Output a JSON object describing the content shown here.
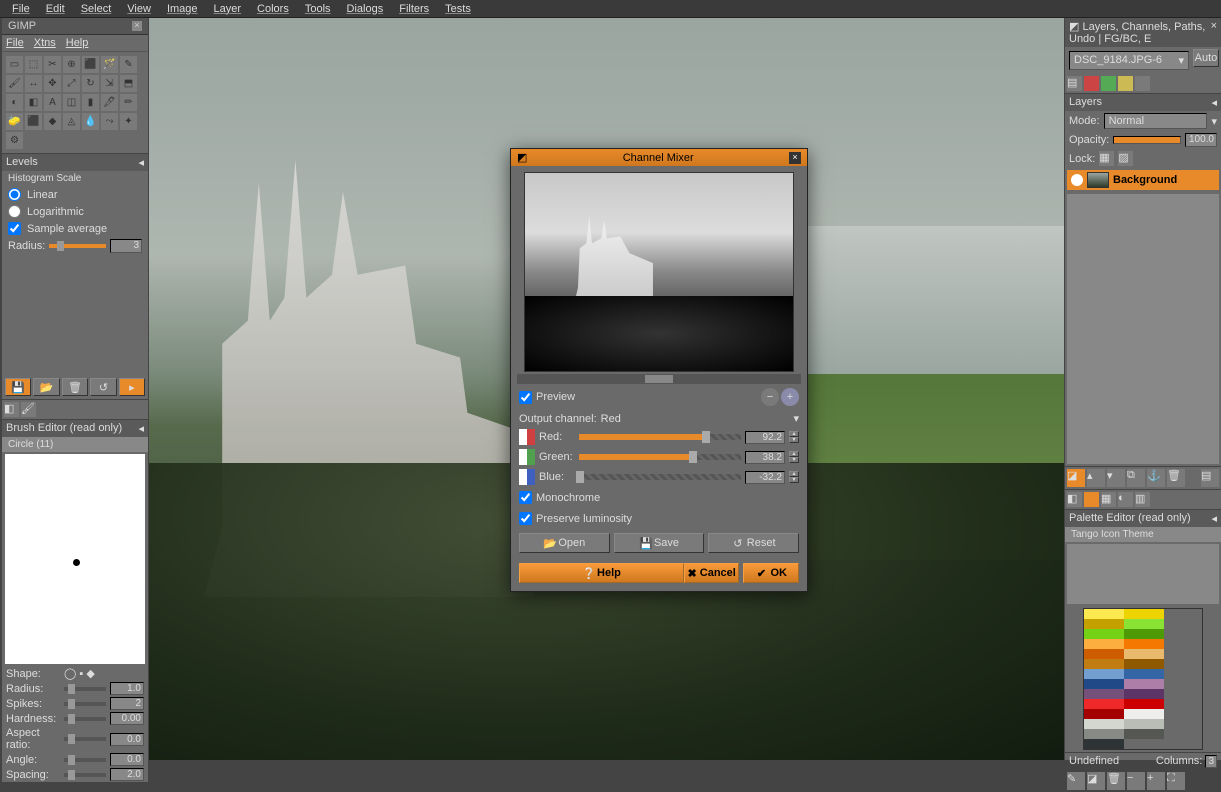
{
  "menubar": [
    "File",
    "Edit",
    "Select",
    "View",
    "Image",
    "Layer",
    "Colors",
    "Tools",
    "Dialogs",
    "Filters",
    "Tests"
  ],
  "toolbox": {
    "title": "GIMP",
    "menu": [
      "File",
      "Xtns",
      "Help"
    ],
    "levels_hdr": "Levels",
    "hist_label": "Histogram Scale",
    "linear": "Linear",
    "log": "Logarithmic",
    "sample_avg": "Sample average",
    "radius_lbl": "Radius:",
    "radius_val": "3",
    "brush_editor_hdr": "Brush Editor (read only)",
    "brush_name": "Circle (11)",
    "sliders": [
      {
        "lbl": "Shape:",
        "val": ""
      },
      {
        "lbl": "Radius:",
        "val": "1.0"
      },
      {
        "lbl": "Spikes:",
        "val": "2"
      },
      {
        "lbl": "Hardness:",
        "val": "0.00"
      },
      {
        "lbl": "Aspect ratio:",
        "val": "0.0"
      },
      {
        "lbl": "Angle:",
        "val": "0.0"
      },
      {
        "lbl": "Spacing:",
        "val": "2.0"
      }
    ]
  },
  "right": {
    "dock_title": "Layers, Channels, Paths, Undo | FG/BC, E",
    "image_name": "DSC_9184.JPG-6",
    "auto": "Auto",
    "layers_hdr": "Layers",
    "mode_lbl": "Mode:",
    "mode_val": "Normal",
    "opacity_lbl": "Opacity:",
    "opacity_val": "100.0",
    "lock_lbl": "Lock:",
    "layer_name": "Background",
    "palette_hdr": "Palette Editor (read only)",
    "palette_name": "Tango Icon Theme",
    "palette_colors": [
      "#fce94f",
      "#edd400",
      "#c4a000",
      "#8ae234",
      "#73d216",
      "#4e9a06",
      "#fcaf3e",
      "#f57900",
      "#ce5c00",
      "#e9b96e",
      "#c17d11",
      "#8f5902",
      "#729fcf",
      "#3465a4",
      "#204a87",
      "#ad7fa8",
      "#75507b",
      "#5c3566",
      "#ef2929",
      "#cc0000",
      "#a40000",
      "#eeeeec",
      "#d3d7cf",
      "#babdb6",
      "#888a85",
      "#555753",
      "#2e3436"
    ],
    "undef": "Undefined",
    "cols_lbl": "Columns:",
    "cols_val": "3"
  },
  "dialog": {
    "title": "Channel Mixer",
    "preview": "Preview",
    "output_lbl": "Output channel:",
    "output_val": "Red",
    "channels": [
      {
        "name": "Red:",
        "val": "92.2",
        "fill": 78,
        "icon": "#d04040"
      },
      {
        "name": "Green:",
        "val": "38.2",
        "fill": 70,
        "icon": "#50a050"
      },
      {
        "name": "Blue:",
        "val": "-32.2",
        "fill": 0,
        "icon": "#4060c0"
      }
    ],
    "mono": "Monochrome",
    "lumin": "Preserve luminosity",
    "open": "Open",
    "save": "Save",
    "reset": "Reset",
    "help": "Help",
    "cancel": "Cancel",
    "ok": "OK"
  }
}
